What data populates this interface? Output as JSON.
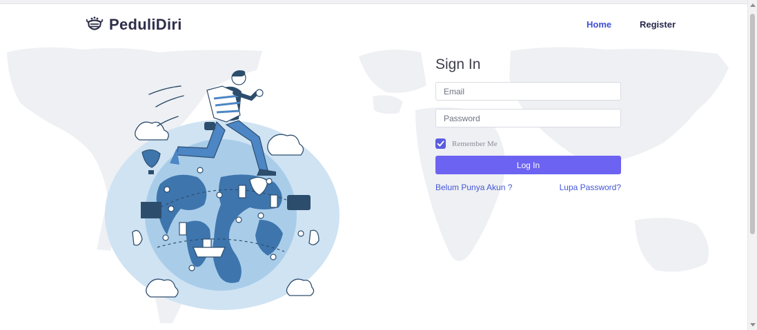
{
  "brand": {
    "name": "PeduliDiri",
    "logo_icon": "mask-logo-icon"
  },
  "nav": {
    "home_label": "Home",
    "register_label": "Register"
  },
  "signin": {
    "title": "Sign In",
    "email_placeholder": "Email",
    "password_placeholder": "Password",
    "remember_label": "Remember Me",
    "remember_checked": true,
    "login_label": "Log In",
    "no_account_link": "Belum Punya Akun ?",
    "forgot_password_link": "Lupa Password?"
  },
  "colors": {
    "accent": "#6c63f2",
    "brand_text": "#2d2e49",
    "link": "#4356d8",
    "globe": "#a9cde9"
  },
  "icons": [
    "mask-logo-icon",
    "checkbox-check-icon",
    "scroll-up-icon",
    "scroll-down-icon"
  ]
}
